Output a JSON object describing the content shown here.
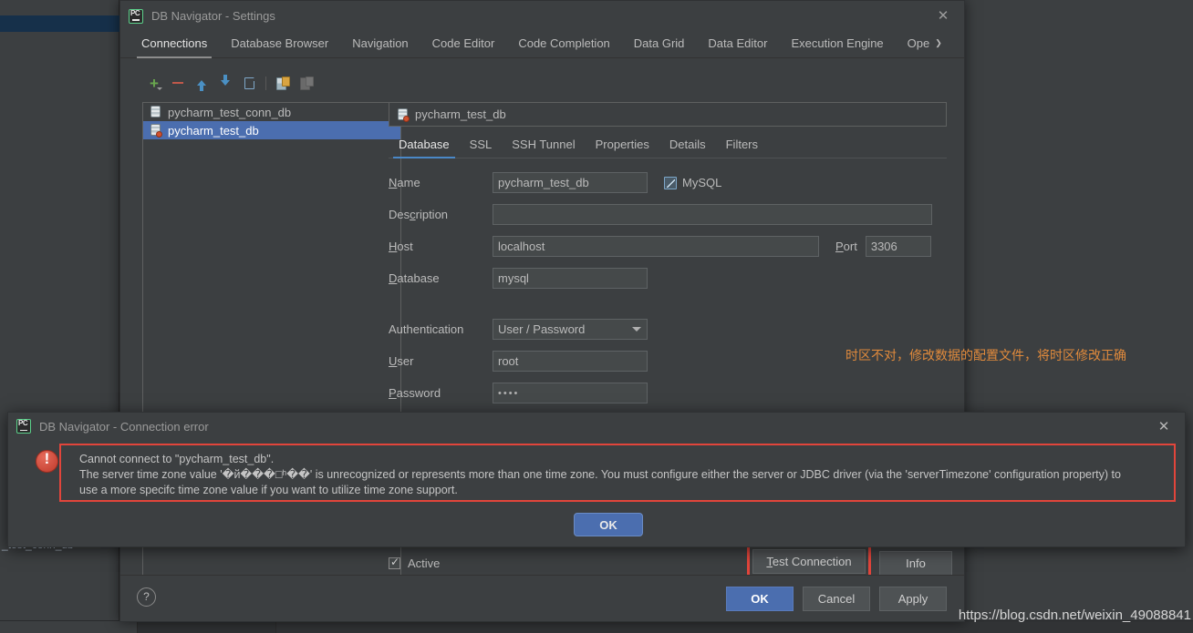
{
  "background": {
    "fragment_text": "_test_conn_db"
  },
  "settings_dialog": {
    "title": "DB Navigator - Settings",
    "logo_alt": "pycharm-logo",
    "close_label": "✕",
    "tabs": [
      {
        "label": "Connections",
        "active": true
      },
      {
        "label": "Database Browser",
        "active": false
      },
      {
        "label": "Navigation",
        "active": false
      },
      {
        "label": "Code Editor",
        "active": false
      },
      {
        "label": "Code Completion",
        "active": false
      },
      {
        "label": "Data Grid",
        "active": false
      },
      {
        "label": "Data Editor",
        "active": false
      },
      {
        "label": "Execution Engine",
        "active": false
      },
      {
        "label": "Ope",
        "active": false
      }
    ],
    "toolbar": [
      {
        "name": "add-connection",
        "icon": "plus-icon"
      },
      {
        "name": "remove-connection",
        "icon": "minus-icon"
      },
      {
        "name": "move-up",
        "icon": "arrow-up-icon"
      },
      {
        "name": "move-down",
        "icon": "arrow-down-icon"
      },
      {
        "name": "duplicate-connection",
        "icon": "copy-icon"
      },
      {
        "name": "import-connection",
        "icon": "database-add-icon"
      },
      {
        "name": "export-connection",
        "icon": "database-export-icon"
      }
    ],
    "connections": [
      {
        "label": "pycharm_test_conn_db",
        "selected": false,
        "has_error_badge": false
      },
      {
        "label": "pycharm_test_db",
        "selected": true,
        "has_error_badge": true
      }
    ],
    "connection_header": "pycharm_test_db",
    "sub_tabs": [
      {
        "label": "Database",
        "active": true
      },
      {
        "label": "SSL",
        "active": false
      },
      {
        "label": "SSH Tunnel",
        "active": false
      },
      {
        "label": "Properties",
        "active": false
      },
      {
        "label": "Details",
        "active": false
      },
      {
        "label": "Filters",
        "active": false
      }
    ],
    "form": {
      "name_label": "Name",
      "name_mnemonic": "N",
      "name_value": "pycharm_test_db",
      "db_type": "MySQL",
      "description_label_pre": "Des",
      "description_mnemonic": "c",
      "description_label_post": "ription",
      "description_value": "",
      "host_label": "Host",
      "host_mnemonic": "H",
      "host_value": "localhost",
      "port_label": "Port",
      "port_mnemonic": "P",
      "port_value": "3306",
      "database_label": "Database",
      "database_mnemonic": "D",
      "database_value": "mysql",
      "authentication_label": "Authentication",
      "authentication_value": "User / Password",
      "user_label": "User",
      "user_mnemonic": "U",
      "user_value": "root",
      "password_label": "Password",
      "password_mnemonic": "P",
      "password_value": "••••"
    },
    "annotation": "时区不对，修改数据的配置文件，将时区修改正确",
    "annotation_color": "#e08a3c",
    "active_checkbox_label": "Active",
    "active_checked": true,
    "test_connection_label": "Test Connection",
    "test_connection_mnemonic": "T",
    "test_connection_highlight_color": "#e2453b",
    "info_label": "Info",
    "help_label": "?",
    "footer_buttons": [
      {
        "label": "OK",
        "primary": true
      },
      {
        "label": "Cancel",
        "primary": false
      },
      {
        "label": "Apply",
        "primary": false
      }
    ]
  },
  "error_dialog": {
    "title": "DB Navigator - Connection error",
    "close_label": "✕",
    "icon": "error-icon",
    "highlight_color": "#e2453b",
    "message_lines": [
      "Cannot connect to \"pycharm_test_db\".",
      "The server time zone value '�й���□ʰ��' is unrecognized or represents more than one time zone. You must configure either the server or JDBC driver (via the 'serverTimezone' configuration property) to",
      "use a more specifc time zone value if you want to utilize time zone support."
    ],
    "ok_label": "OK"
  },
  "watermark": "https://blog.csdn.net/weixin_49088841"
}
